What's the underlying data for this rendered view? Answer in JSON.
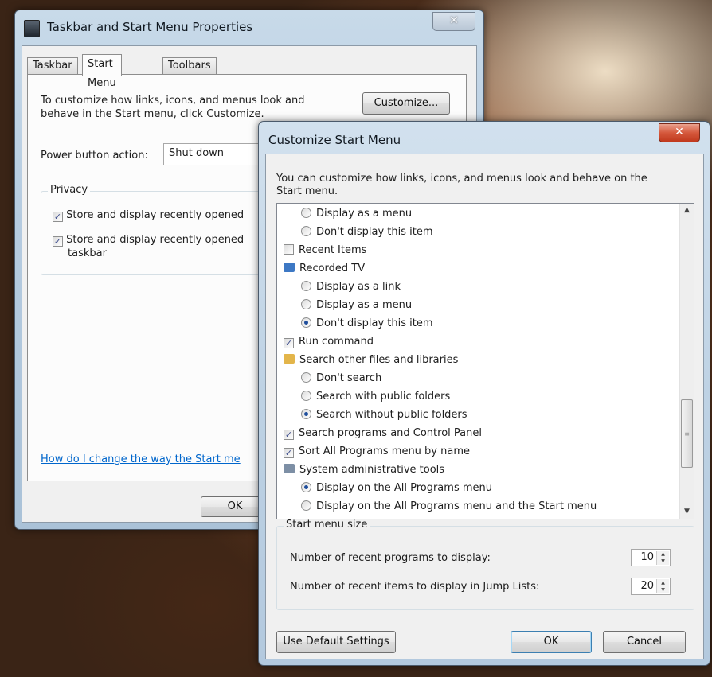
{
  "taskbar_window": {
    "title": "Taskbar and Start Menu Properties",
    "tabs": [
      "Taskbar",
      "Start Menu",
      "Toolbars"
    ],
    "active_tab": "Start Menu",
    "customize_text": "To customize how links, icons, and menus look and behave in the Start menu, click Customize.",
    "customize_button": "Customize...",
    "power_label": "Power button action:",
    "power_value": "Shut down",
    "privacy_label": "Privacy",
    "privacy_items": [
      {
        "label": "Store and display recently opened",
        "checked": true
      },
      {
        "label": "Store and display recently opened",
        "label2": "taskbar",
        "checked": true
      }
    ],
    "help_link": "How do I change the way the Start me",
    "ok_button": "OK",
    "close_glyph": "✕"
  },
  "customize_window": {
    "title": "Customize Start Menu",
    "description": "You can customize how links, icons, and menus look and behave on the Start menu.",
    "items": [
      {
        "type": "radio",
        "label": "Display as a menu",
        "checked": false,
        "indent": 1
      },
      {
        "type": "radio",
        "label": "Don't display this item",
        "checked": false,
        "indent": 1
      },
      {
        "type": "checkbox",
        "label": "Recent Items",
        "checked": false,
        "indent": 0
      },
      {
        "type": "icon",
        "icon": "recorded-tv-icon",
        "label": "Recorded TV",
        "indent": 0
      },
      {
        "type": "radio",
        "label": "Display as a link",
        "checked": false,
        "indent": 1
      },
      {
        "type": "radio",
        "label": "Display as a menu",
        "checked": false,
        "indent": 1
      },
      {
        "type": "radio",
        "label": "Don't display this item",
        "checked": true,
        "indent": 1
      },
      {
        "type": "checkbox",
        "label": "Run command",
        "checked": true,
        "indent": 0
      },
      {
        "type": "icon",
        "icon": "search-files-icon",
        "label": "Search other files and libraries",
        "indent": 0
      },
      {
        "type": "radio",
        "label": "Don't search",
        "checked": false,
        "indent": 1
      },
      {
        "type": "radio",
        "label": "Search with public folders",
        "checked": false,
        "indent": 1
      },
      {
        "type": "radio",
        "label": "Search without public folders",
        "checked": true,
        "indent": 1
      },
      {
        "type": "checkbox",
        "label": "Search programs and Control Panel",
        "checked": true,
        "indent": 0
      },
      {
        "type": "checkbox",
        "label": "Sort All Programs menu by name",
        "checked": true,
        "indent": 0
      },
      {
        "type": "icon",
        "icon": "admin-tools-icon",
        "label": "System administrative tools",
        "indent": 0
      },
      {
        "type": "radio",
        "label": "Display on the All Programs menu",
        "checked": true,
        "indent": 1
      },
      {
        "type": "radio",
        "label": "Display on the All Programs menu and the Start menu",
        "checked": false,
        "indent": 1
      }
    ],
    "size_group_label": "Start menu size",
    "recent_programs_label": "Number of recent programs to display:",
    "recent_programs_value": "10",
    "jump_list_label": "Number of recent items to display in Jump Lists:",
    "jump_list_value": "20",
    "default_button": "Use Default Settings",
    "ok_button": "OK",
    "cancel_button": "Cancel",
    "close_glyph": "✕",
    "icon_colors": {
      "recorded-tv-icon": "#3d78c4",
      "search-files-icon": "#e3b54a",
      "admin-tools-icon": "#7d8fa5"
    }
  }
}
